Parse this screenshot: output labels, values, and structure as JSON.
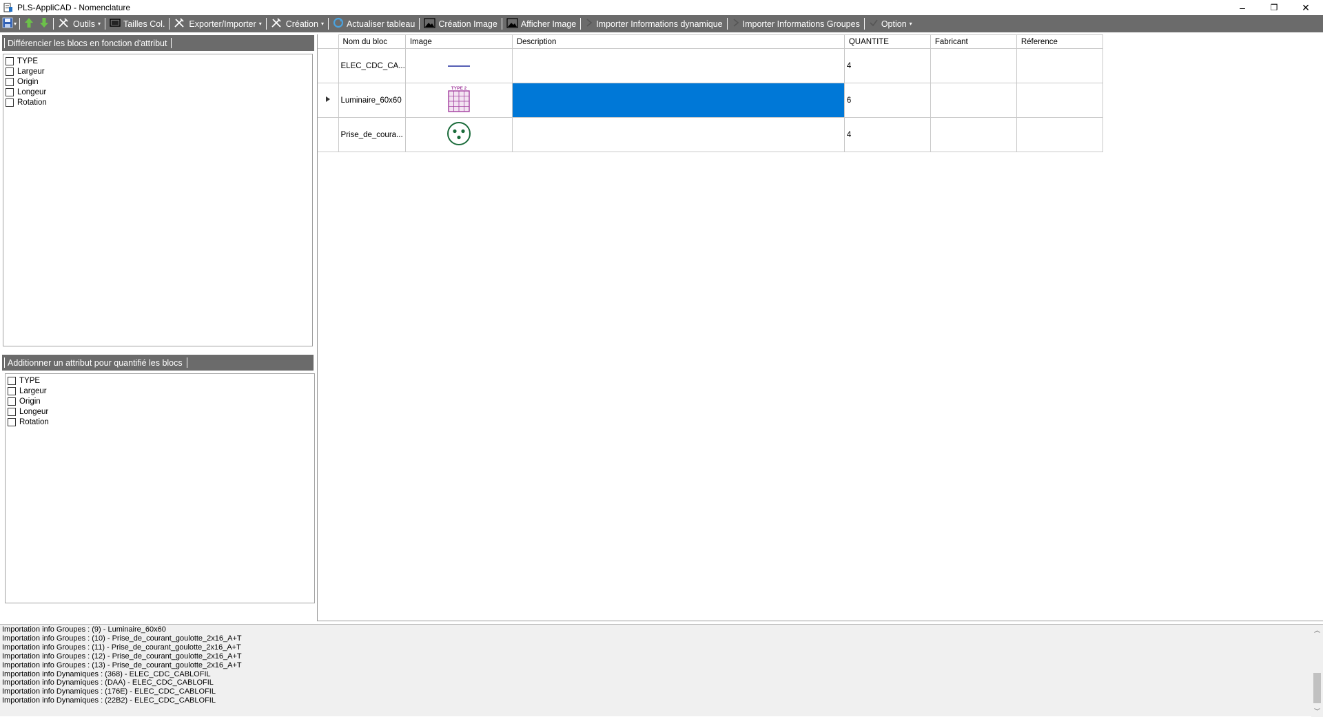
{
  "window": {
    "title": "PLS-AppliCAD - Nomenclature",
    "minimize": "–",
    "maximize": "❐",
    "close": "✕"
  },
  "toolbar": {
    "items": [
      {
        "label": "Outils",
        "icon": "tools-icon",
        "dropdown": true
      },
      {
        "label": "Tailles Col.",
        "icon": "column-size-icon",
        "dropdown": false
      },
      {
        "label": "Exporter/Importer",
        "icon": "tools-icon",
        "dropdown": true
      },
      {
        "label": "Création",
        "icon": "tools-icon",
        "dropdown": true
      },
      {
        "label": "Actualiser tableau",
        "icon": "refresh-icon",
        "dropdown": false
      },
      {
        "label": "Création Image",
        "icon": "image-icon",
        "dropdown": false
      },
      {
        "label": "Afficher Image",
        "icon": "image-icon",
        "dropdown": false
      },
      {
        "label": "Importer Informations dynamique",
        "icon": "chevron-right-icon",
        "dropdown": false
      },
      {
        "label": "Importer Informations Groupes",
        "icon": "chevron-right-icon",
        "dropdown": false
      },
      {
        "label": "Option",
        "icon": "checkmark-icon",
        "dropdown": true
      }
    ]
  },
  "panel_top": {
    "title": "Différencier les blocs en fonction d'attribut",
    "items": [
      "TYPE",
      "Largeur",
      "Origin",
      "Longeur",
      "Rotation"
    ]
  },
  "panel_bottom": {
    "title": "Additionner un attribut pour quantifié les blocs",
    "items": [
      "TYPE",
      "Largeur",
      "Origin",
      "Longeur",
      "Rotation"
    ]
  },
  "grid": {
    "columns": [
      "Nom du bloc",
      "Image",
      "Description",
      "QUANTITE",
      "Fabricant",
      "Réference"
    ],
    "rows": [
      {
        "name": "ELEC_CDC_CA...",
        "image": "line-symbol-icon",
        "description": "",
        "quantite": "4",
        "fabricant": "",
        "reference": "",
        "selected": false
      },
      {
        "name": "Luminaire_60x60",
        "image": "luminaire-symbol-icon",
        "image_text": "TYPE 2",
        "description": "",
        "quantite": "6",
        "fabricant": "",
        "reference": "",
        "selected": true
      },
      {
        "name": "Prise_de_coura...",
        "image": "outlet-symbol-icon",
        "description": "",
        "quantite": "4",
        "fabricant": "",
        "reference": "",
        "selected": false
      }
    ]
  },
  "log": {
    "lines": [
      "Importation info Groupes : (9) - Luminaire_60x60",
      "Importation info Groupes : (10) - Prise_de_courant_goulotte_2x16_A+T",
      "Importation info Groupes : (11) - Prise_de_courant_goulotte_2x16_A+T",
      "Importation info Groupes : (12) - Prise_de_courant_goulotte_2x16_A+T",
      "Importation info Groupes : (13) - Prise_de_courant_goulotte_2x16_A+T",
      "Importation info Dynamiques : (368) - ELEC_CDC_CABLOFIL",
      "Importation info Dynamiques : (DAA) - ELEC_CDC_CABLOFIL",
      "Importation info Dynamiques : (176E) - ELEC_CDC_CABLOFIL",
      "Importation info Dynamiques : (22B2) - ELEC_CDC_CABLOFIL"
    ]
  },
  "colors": {
    "toolbar_bg": "#6b6b6b",
    "selection": "#0078d7",
    "luminaire": "#a23d9e",
    "outlet": "#1a6b3a",
    "line_symbol": "#1f2a9c"
  }
}
